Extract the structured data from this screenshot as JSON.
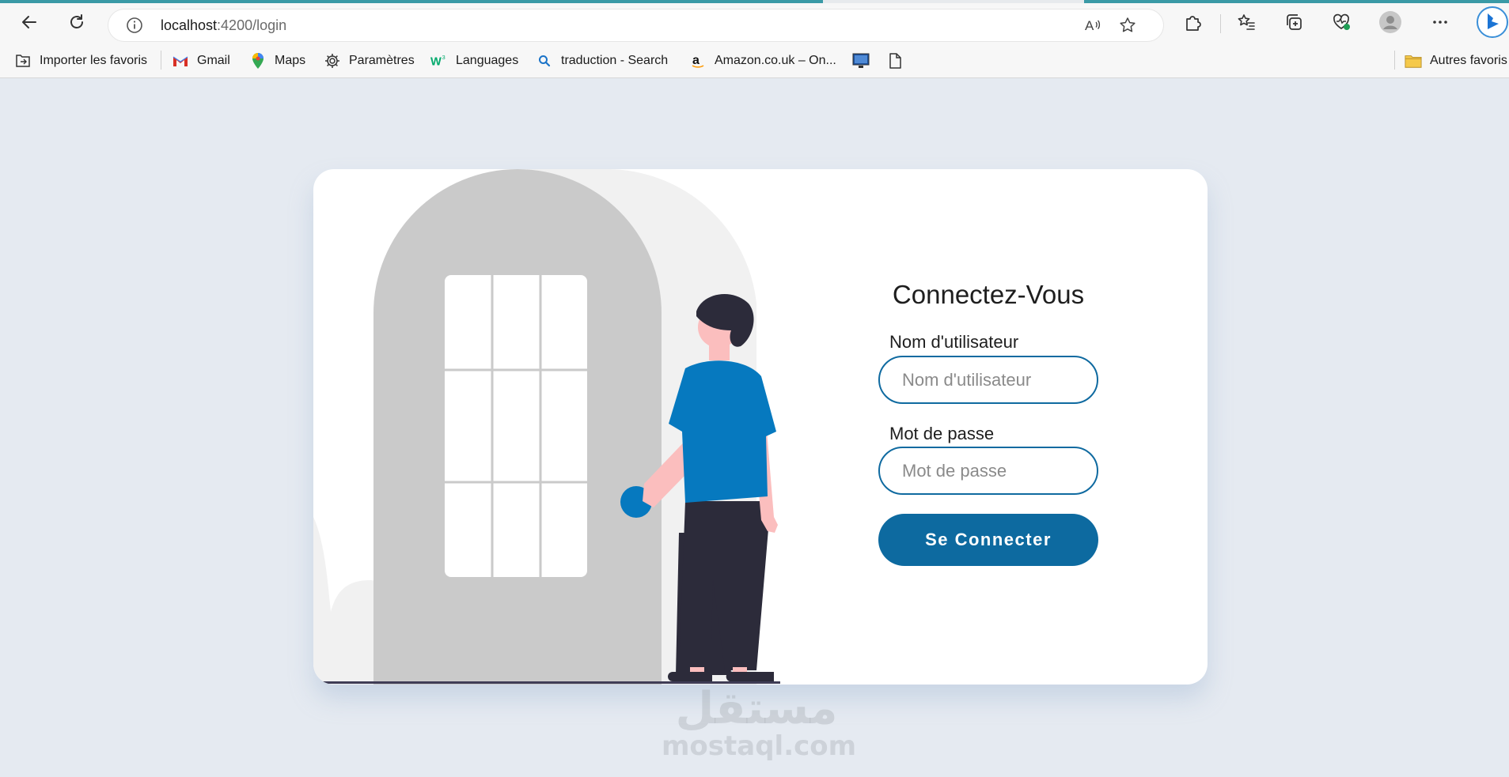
{
  "browser": {
    "url_host": "localhost",
    "url_path": ":4200/login"
  },
  "bookmarks": [
    {
      "label": "Importer les favoris",
      "icon": "import-favorites-icon"
    },
    {
      "label": "Gmail",
      "icon": "gmail-icon"
    },
    {
      "label": "Maps",
      "icon": "maps-pin-icon"
    },
    {
      "label": "Paramètres",
      "icon": "gear-icon"
    },
    {
      "label": "Languages",
      "icon": "w3schools-icon"
    },
    {
      "label": "traduction - Search",
      "icon": "search-icon"
    },
    {
      "label": "Amazon.co.uk – On...",
      "icon": "amazon-icon"
    },
    {
      "label": "Autres favoris",
      "icon": "folder-icon"
    }
  ],
  "login": {
    "title": "Connectez-Vous",
    "username_label": "Nom d'utilisateur",
    "username_placeholder": "Nom d'utilisateur",
    "username_value": "",
    "password_label": "Mot de passe",
    "password_placeholder": "Mot de passe",
    "password_value": "",
    "submit_label": "Se Connecter"
  },
  "watermark": {
    "arabic": "مستقل",
    "latin": "mostaql.com"
  },
  "colors": {
    "page_bg": "#e5eaf1",
    "accent": "#0d6aa0",
    "door": "#cacaca",
    "shirt": "#0679bf",
    "pants": "#2c2b3a"
  }
}
